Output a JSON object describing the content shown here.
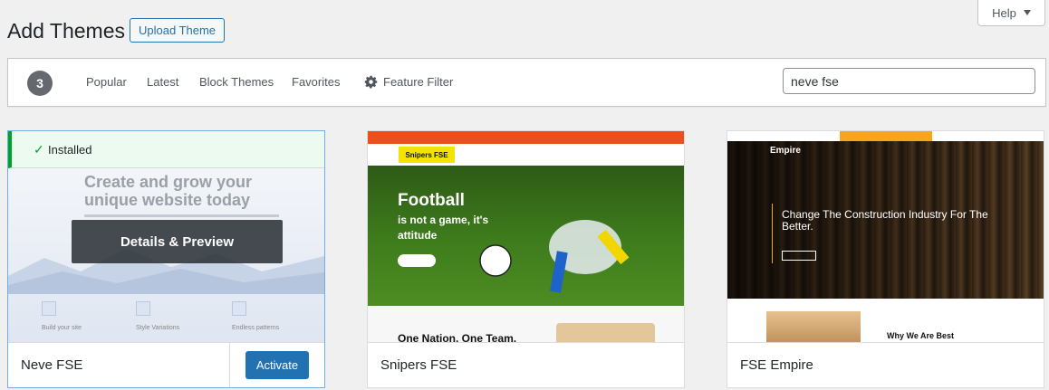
{
  "help": {
    "label": "Help"
  },
  "header": {
    "title": "Add Themes",
    "upload_label": "Upload Theme"
  },
  "filter": {
    "count": "3",
    "links": [
      "Popular",
      "Latest",
      "Block Themes",
      "Favorites"
    ],
    "feature_filter": "Feature Filter",
    "search_value": "neve fse"
  },
  "themes": [
    {
      "name": "Neve FSE",
      "installed_label": "Installed",
      "details_label": "Details & Preview",
      "activate_label": "Activate",
      "preview": {
        "headline": "Create and grow your unique website today",
        "features": [
          "Build your site",
          "Style Variations",
          "Endless patterns"
        ]
      }
    },
    {
      "name": "Snipers FSE",
      "preview": {
        "logo": "Snipers FSE",
        "headline": "Football",
        "subline": "is not a game, it's attitude",
        "lower_title": "One Nation. One Team."
      }
    },
    {
      "name": "FSE Empire",
      "preview": {
        "brand": "Empire",
        "headline": "Change The Construction Industry For The Better.",
        "lower_title": "Why We Are Best"
      }
    }
  ],
  "colors": {
    "accent": "#2271b1",
    "installed": "#00a32a",
    "snipers_orange": "#ec4f1e",
    "empire_orange": "#f9a51b"
  }
}
